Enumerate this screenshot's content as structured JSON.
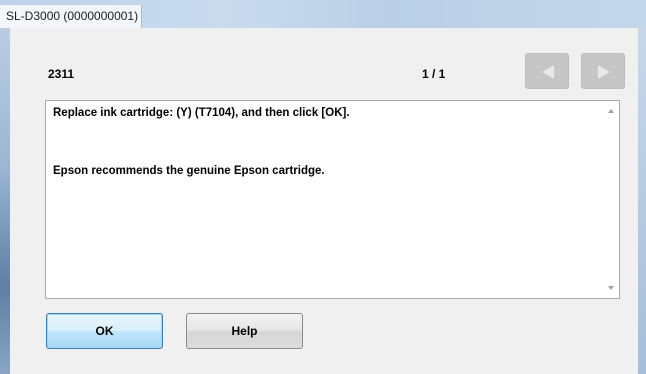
{
  "window": {
    "title": "SL-D3000 (0000000001)"
  },
  "header": {
    "code": "2311",
    "page_indicator": "1 / 1",
    "prev_icon": "left-arrow-icon",
    "next_icon": "right-arrow-icon"
  },
  "message": {
    "line1": "Replace ink cartridge: (Y) (T7104), and then click [OK].",
    "line2": "Epson recommends the genuine Epson cartridge."
  },
  "buttons": {
    "ok_label": "OK",
    "help_label": "Help"
  },
  "colors": {
    "window_bg": "#f0f0f0",
    "nav_button_disabled": "#c6c6c6",
    "ok_button_focus_border": "#3c7fb1"
  }
}
